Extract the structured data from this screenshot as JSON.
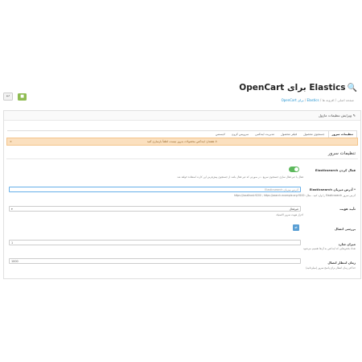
{
  "header": {
    "title": "Elastics برای OpenCart",
    "breadcrumb": {
      "home": "صفحه اصلی",
      "sep1": " / ",
      "modules": "افزونه ها",
      "sep2": " / ",
      "current": "Elastics",
      "sep3": " / ",
      "last": "برای OpenCart"
    }
  },
  "panel": {
    "heading": "ویرایش تنظیمات ماژول",
    "tabs": [
      {
        "label": "تنظیمات سرور"
      },
      {
        "label": "جستجوی محصول"
      },
      {
        "label": "فیلتر محصول"
      },
      {
        "label": "مدیریت ایندکس"
      },
      {
        "label": "سرویس کرون"
      },
      {
        "label": "لایسنس"
      }
    ],
    "alert": "هشدار: ایندکس محصولات به‌روز نیست، لطفاً بازسازی کنید",
    "section_title": "تنظیمات سرور"
  },
  "fields": {
    "enable": {
      "label": "فعال کردن Elasticsearch",
      "help": "فعال یا غیر فعال سازی جستجوی سریع - در صورتی که غیر فعال باشد از جستجوی پیش‌فرض اپن کارت استفاده خواهد شد"
    },
    "hosts": {
      "label": "* آدرس میزبان Elasticsearch",
      "placeholder": "آدرس میزبان Elasticsearch",
      "help": "آدرس سرور Elasticsearch را وارد کنید - مثال: https://localhost:9200 ; https://search.example.org:9200"
    },
    "auth": {
      "label": "تأیید هویت",
      "selected": "غیرفعال",
      "help": "احراز هویت سرور الاستیک"
    },
    "test": {
      "label": "بررسی اتصال"
    },
    "batch": {
      "label": "میزان شارد",
      "value": "1",
      "help": "تعداد بخش‌هایی که ایندکس به آن‌ها تقسیم می‌شود"
    },
    "timeout": {
      "label": "زمان انتظار اتصال",
      "value": "1000",
      "help": "حداکثر زمان انتظار برای پاسخ سرور (میلی‌ثانیه)"
    }
  },
  "icons": {
    "title_icon": "search-icon",
    "save": "save-icon",
    "back": "reply-icon",
    "pencil": "pencil-icon",
    "warning": "warning-icon",
    "close": "close-icon"
  }
}
